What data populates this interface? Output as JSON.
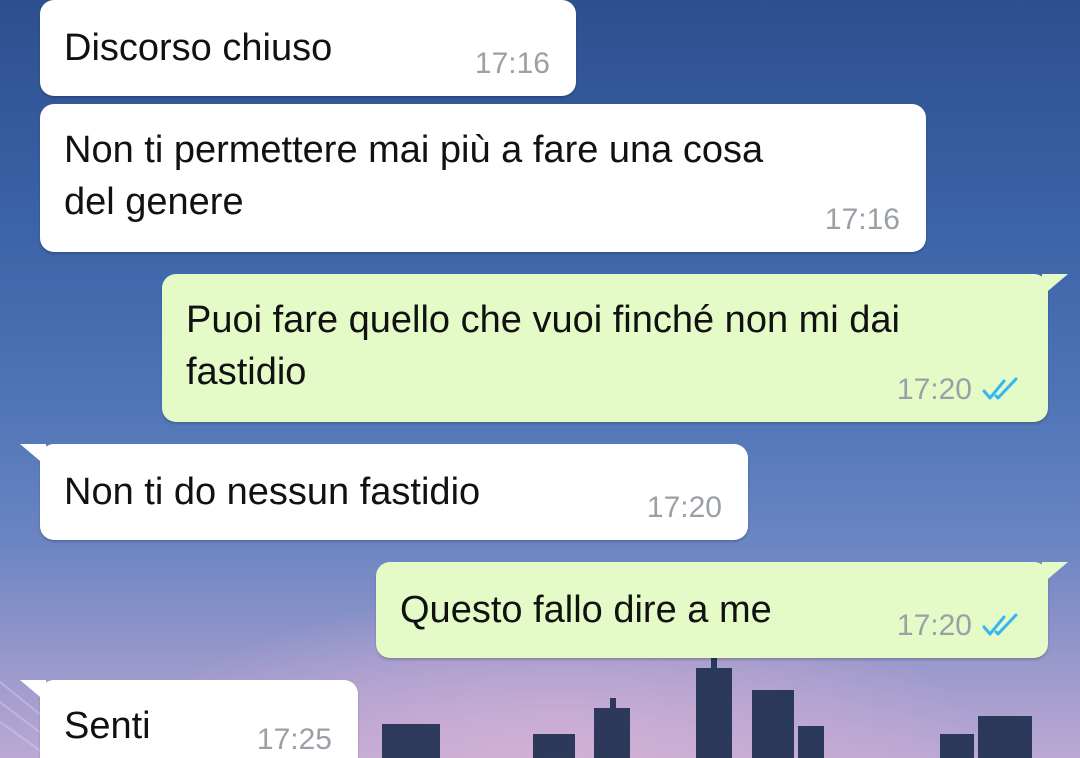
{
  "colors": {
    "incoming_bubble": "#ffffff",
    "outgoing_bubble": "#e4fbc8",
    "read_ticks": "#34b7f1",
    "timestamp": "#9aa0a6"
  },
  "messages": [
    {
      "direction": "incoming",
      "text": "Discorso chiuso",
      "time": "17:16"
    },
    {
      "direction": "incoming",
      "text": "Non ti permettere mai più a fare una cosa\ndel genere",
      "time": "17:16"
    },
    {
      "direction": "outgoing",
      "text": "Puoi fare quello che vuoi finché non mi dai\nfastidio",
      "time": "17:20",
      "status": "read-double-check-icon"
    },
    {
      "direction": "incoming",
      "text": "Non ti do nessun fastidio",
      "time": "17:20"
    },
    {
      "direction": "outgoing",
      "text": "Questo fallo dire a me",
      "time": "17:20",
      "status": "read-double-check-icon"
    },
    {
      "direction": "incoming",
      "text": "Senti",
      "time": "17:25"
    }
  ]
}
